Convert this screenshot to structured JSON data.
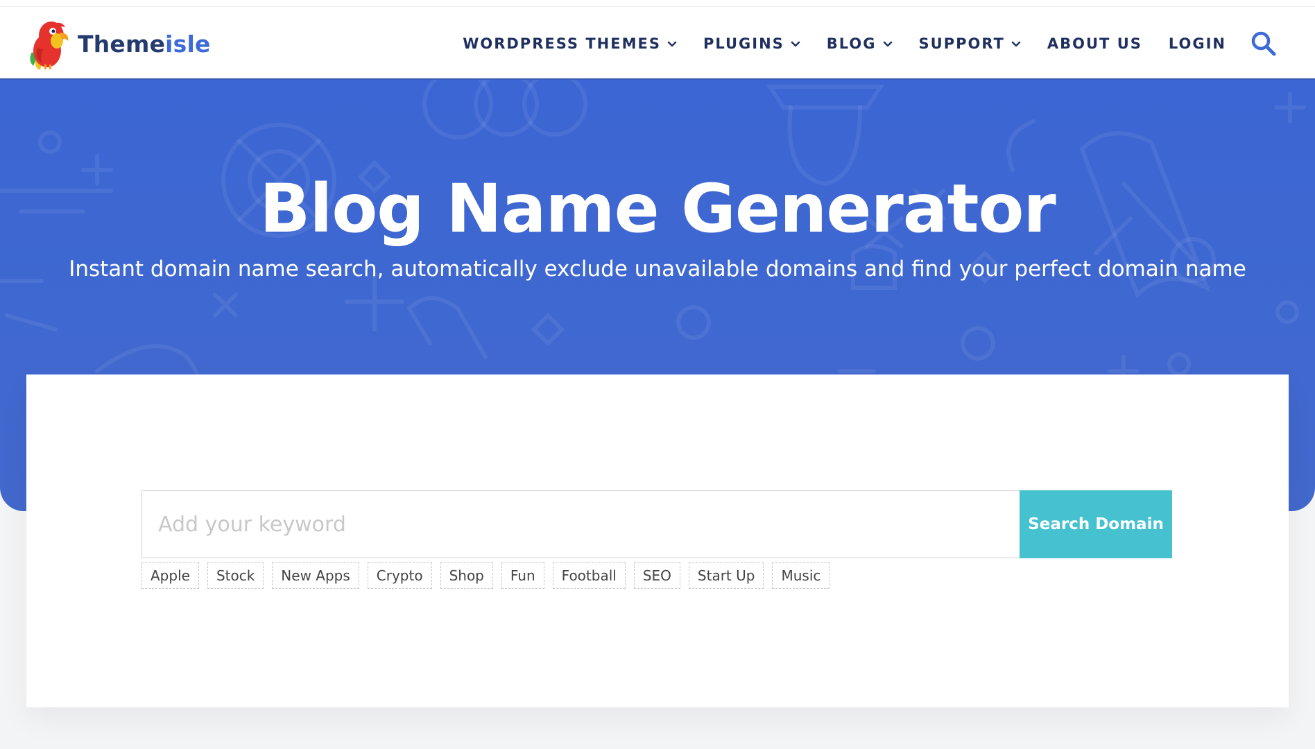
{
  "brand": {
    "name_part1": "Theme",
    "name_part2": "isle"
  },
  "nav": {
    "items": [
      {
        "label": "WORDPRESS THEMES",
        "has_dropdown": true
      },
      {
        "label": "PLUGINS",
        "has_dropdown": true
      },
      {
        "label": "BLOG",
        "has_dropdown": true
      },
      {
        "label": "SUPPORT",
        "has_dropdown": true
      },
      {
        "label": "ABOUT US",
        "has_dropdown": false
      },
      {
        "label": "LOGIN",
        "has_dropdown": false
      }
    ],
    "search_icon": "search-icon"
  },
  "hero": {
    "title": "Blog Name Generator",
    "subtitle": "Instant domain name search, automatically exclude unavailable domains and find your perfect domain name"
  },
  "search": {
    "placeholder": "Add your keyword",
    "value": "",
    "button_label": "Search Domain"
  },
  "keywords": [
    "Apple",
    "Stock",
    "New Apps",
    "Crypto",
    "Shop",
    "Fun",
    "Football",
    "SEO",
    "Start Up",
    "Music"
  ],
  "colors": {
    "brand_dark": "#243b6e",
    "brand_blue": "#3d6ad6",
    "hero_bg": "#3f68d0",
    "button": "#45c1cf",
    "nav_text": "#1f2f5e"
  }
}
